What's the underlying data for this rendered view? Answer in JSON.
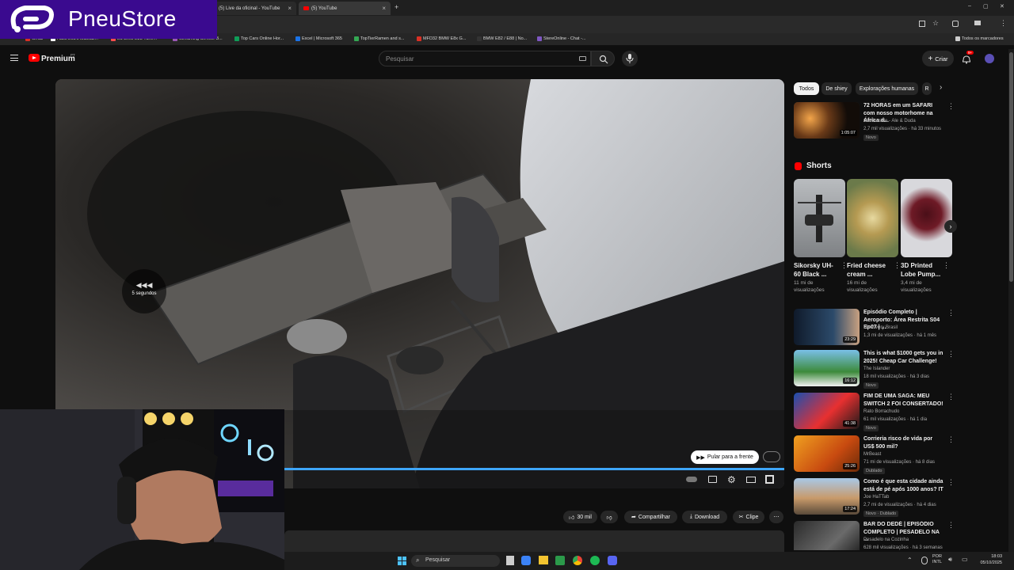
{
  "browser": {
    "tabs": [
      {
        "label": "(5) Live da oficinal - YouTube",
        "close": "×"
      },
      {
        "label": "(5) YouTube",
        "close": "×"
      }
    ],
    "new_tab": "+",
    "window_controls": [
      "–",
      "▢",
      "✕"
    ],
    "bookmarks": [
      {
        "label": "Gmail",
        "color": "#d93025"
      },
      {
        "label": "Hack Ecu's Maxxall...",
        "color": "#ffffff"
      },
      {
        "label": "LS Bmw E28 Tune...",
        "color": "#ff4d4d"
      },
      {
        "label": "Streaming Service B...",
        "color": "#9b59b6"
      },
      {
        "label": "Top Cars Online Hor...",
        "color": "#0f9d58"
      },
      {
        "label": "Excel | Microsoft 365",
        "color": "#1a73e8"
      },
      {
        "label": "TopTierRamen and s...",
        "color": "#34a853"
      },
      {
        "label": "MFD32 BMW E8x G...",
        "color": "#d93025"
      },
      {
        "label": "BMW E82 / E88 | No...",
        "color": "#333333"
      },
      {
        "label": "StereOnline - Chat -...",
        "color": "#7e57c2"
      }
    ],
    "all_bookmarks": "Todos os marcadores"
  },
  "overlay": {
    "brand": "PneuStore",
    "brand_color": "#3a0a8f"
  },
  "youtube": {
    "logo": "Premium",
    "logo_suffix": "PT",
    "search_placeholder": "Pesquisar",
    "create_label": "Criar",
    "notif_count": "9+",
    "player": {
      "seek_hint": "5 segundos",
      "skip_label": "Pular para a frente"
    },
    "actions": {
      "likes": "30 mil",
      "share": "Compartilhar",
      "download": "Download",
      "clip": "Clipe",
      "more": "⋯"
    },
    "chips": [
      "Todos",
      "De shiey",
      "Explorações humanas",
      "R"
    ],
    "shorts_title": "Shorts",
    "first_rec": {
      "title": "72 HORAS em um SAFARI com nosso motorhome na África d...",
      "channel": "GetOutside - Ale & Duda",
      "meta": "2,7 mil visualizações · há 33 minutos",
      "badge": "Novo",
      "duration": "1:05:07"
    },
    "shorts": [
      {
        "title": "Sikorsky UH-60 Black ...",
        "views": "11 mi de visualizações"
      },
      {
        "title": "Fried cheese cream ...",
        "views": "16 mi de visualizações"
      },
      {
        "title": "3D Printed Lobe Pump...",
        "views": "3,4 mi de visualizações"
      }
    ],
    "recs": [
      {
        "title": "Episódio Completo | Aeroporto: Área Restrita S04 Ep07 | ...",
        "channel": "Discovery Brasil",
        "meta": "1,3 mi de visualizações · há 1 mês",
        "badge": "",
        "duration": "23:29"
      },
      {
        "title": "This is what $1000 gets you in 2025! Cheap Car Challenge!",
        "channel": "The Islander",
        "meta": "18 mil visualizações · há 3 dias",
        "badge": "Novo",
        "duration": "16:12"
      },
      {
        "title": "FIM DE UMA SAGA: MEU SWITCH 2 FOI CONSERTADO!",
        "channel": "Rato Borrachudo",
        "meta": "61 mil visualizações · há 1 dia",
        "badge": "Novo",
        "duration": "41:38"
      },
      {
        "title": "Corrieria risco de vida por US$ 500 mil?",
        "channel": "MrBeast",
        "meta": "71 mi de visualizações · há 8 dias",
        "badge": "Dublado",
        "duration": "25:26"
      },
      {
        "title": "Como é que esta cidade ainda está de pé após 1000 anos? IT",
        "channel": "Joe HaTTab",
        "meta": "2,7 mi de visualizações · há 4 dias",
        "badge": "Novo · Dublado",
        "duration": "17:24"
      },
      {
        "title": "BAR DO DEDÉ | EPISÓDIO COMPLETO | PESADELO NA ...",
        "channel": "Pesadelo na Cozinha",
        "meta": "628 mil visualizações · há 3 semanas",
        "badge": "",
        "duration": ""
      }
    ]
  },
  "taskbar": {
    "search": "Pesquisar",
    "lang1": "POR",
    "lang2": "INTL",
    "time": "18:03",
    "date": "05/10/2025"
  }
}
